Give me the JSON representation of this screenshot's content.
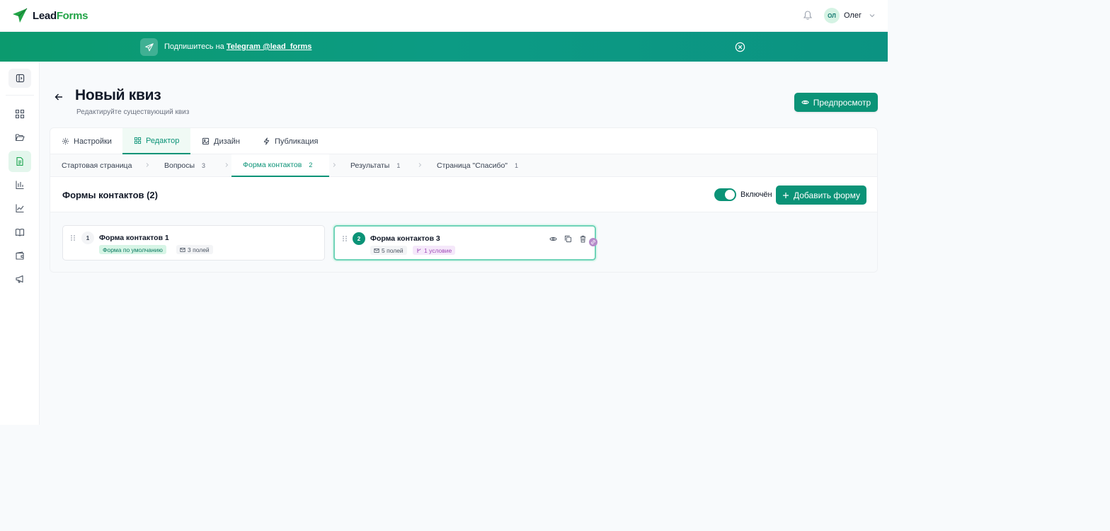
{
  "header": {
    "logo_lead": "Lead",
    "logo_forms": "Forms",
    "user_initials": "ОЛ",
    "user_name": "Олег"
  },
  "banner": {
    "text": "Подпишитесь на ",
    "link": "Telegram @lead_forms"
  },
  "page": {
    "title": "Новый квиз",
    "subtitle": "Редактируйте существующий квиз",
    "preview_label": "Предпросмотр"
  },
  "tabs": [
    {
      "label": "Настройки",
      "icon": "gear-icon"
    },
    {
      "label": "Редактор",
      "icon": "grid-icon",
      "active": true
    },
    {
      "label": "Дизайн",
      "icon": "image-icon"
    },
    {
      "label": "Публикация",
      "icon": "lightning-icon"
    }
  ],
  "steps": [
    {
      "label": "Стартовая страница",
      "count": ""
    },
    {
      "label": "Вопросы",
      "count": "3"
    },
    {
      "label": "Форма контактов",
      "count": "2",
      "active": true
    },
    {
      "label": "Результаты",
      "count": "1"
    },
    {
      "label": "Страница \"Спасибо\"",
      "count": "1"
    }
  ],
  "section": {
    "title": "Формы контактов (2)",
    "toggle_label": "Включён",
    "toggle_on": true,
    "add_label": "Добавить форму"
  },
  "forms": [
    {
      "number": "1",
      "name": "Форма контактов 1",
      "default_badge": "Форма по умолчанию",
      "fields": "3 полей"
    },
    {
      "number": "2",
      "name": "Форма контактов 3",
      "fields": "5 полей",
      "condition": "1 условие",
      "selected": true
    }
  ],
  "colors": {
    "accent": "#0b9377",
    "brand_green": "#22a447",
    "banner": "#0b9a6e"
  }
}
